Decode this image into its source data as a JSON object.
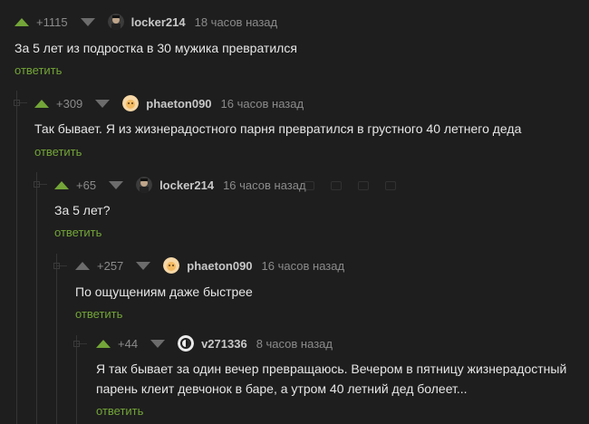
{
  "comments": [
    {
      "rating": "+1115",
      "user": "locker214",
      "time": "18 часов назад",
      "text": "За 5 лет из подростка в 30 мужика превратился",
      "reply": "ответить"
    },
    {
      "rating": "+309",
      "user": "phaeton090",
      "time": "16 часов назад",
      "text": "Так бывает. Я из жизнерадостного парня превратился в грустного 40 летнего деда",
      "reply": "ответить"
    },
    {
      "rating": "+65",
      "user": "locker214",
      "time": "16 часов назад",
      "text": "За 5 лет?",
      "reply": "ответить"
    },
    {
      "rating": "+257",
      "user": "phaeton090",
      "time": "16 часов назад",
      "text": "По ощущениям даже быстрее",
      "reply": "ответить"
    },
    {
      "rating": "+44",
      "user": "v271336",
      "time": "8 часов назад",
      "text_line1": "Я так бывает за один вечер превращаюсь. Вечером в пятницу жизнерадостный",
      "text_line2": "парень клеит девчонок в баре, а утром 40 летний дед болеет...",
      "reply": "ответить"
    }
  ],
  "colors": {
    "background": "#1e1e1e",
    "upvote": "#73a538",
    "reply_link": "#73a538",
    "text": "#e6e6e6",
    "meta": "#8b8b8b"
  }
}
